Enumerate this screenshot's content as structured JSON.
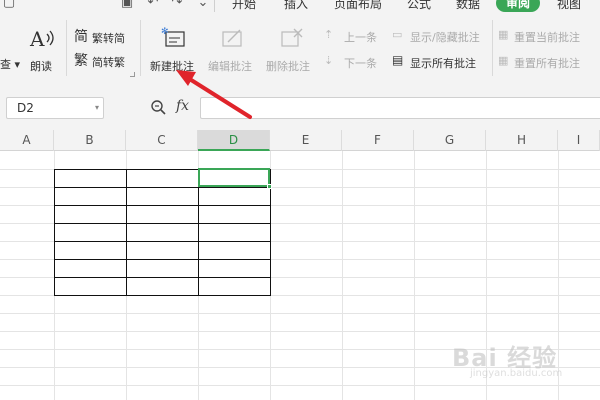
{
  "menu": {
    "items": [
      "开始",
      "插入",
      "页面布局",
      "公式",
      "数据",
      "审阅",
      "视图"
    ],
    "active": "审阅"
  },
  "ribbon": {
    "left_partial": "查",
    "read_aloud": "朗读",
    "trad_simplified": "繁转简",
    "simplified_trad": "简转繁",
    "new_comment": "新建批注",
    "edit_comment": "编辑批注",
    "delete_comment": "删除批注",
    "prev": "上一条",
    "next": "下一条",
    "show_hide_comment": "显示/隐藏批注",
    "show_all_comments": "显示所有批注",
    "reset_current_comment": "重置当前批注",
    "reset_all_comments": "重置所有批注"
  },
  "formula_bar": {
    "name_box": "D2",
    "fx_label": "fx",
    "value": ""
  },
  "sheet": {
    "columns": [
      "A",
      "B",
      "C",
      "D",
      "E",
      "F",
      "G",
      "H",
      "I"
    ],
    "active_column": "D",
    "selected_cell": "D2"
  },
  "watermark": {
    "text": "Bai 经验",
    "sub": "jingyan.baidu.com"
  },
  "colors": {
    "accent": "#3aa657",
    "ribbon_bg": "#f3f3f3",
    "arrow": "#e0242b"
  }
}
